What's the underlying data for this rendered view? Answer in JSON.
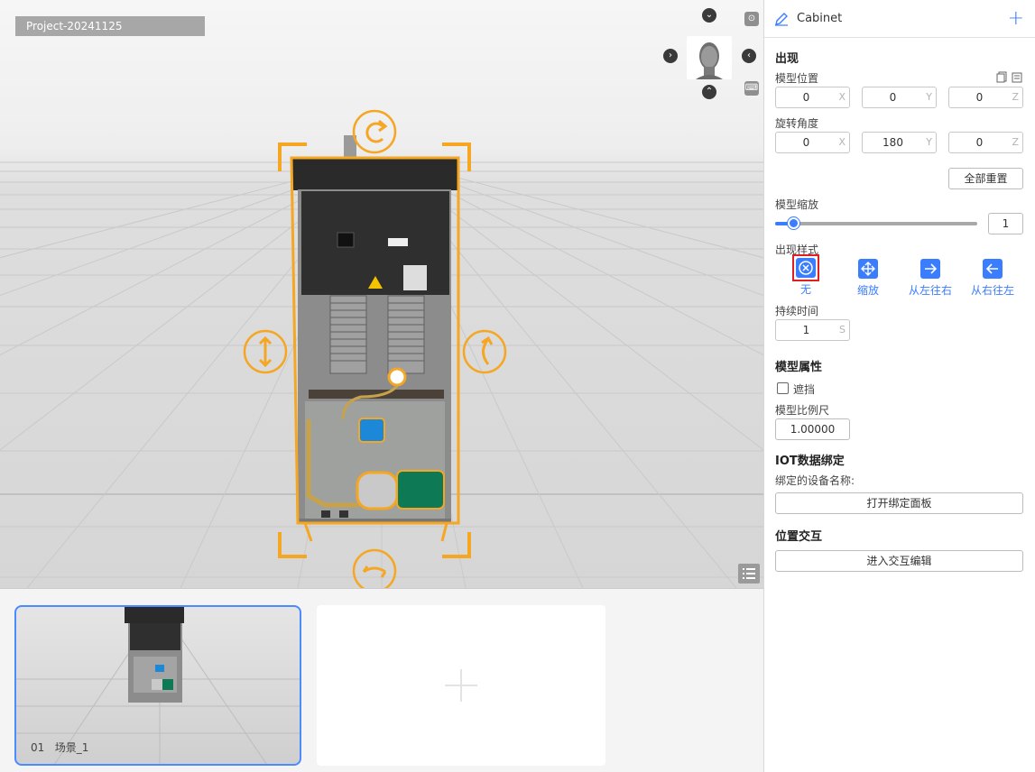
{
  "viewport": {
    "project_name": "Project-20241125"
  },
  "panel": {
    "header_title": "Cabinet",
    "section_appear": "出现",
    "position_label": "模型位置",
    "position": {
      "x": "0",
      "y": "0",
      "z": "0"
    },
    "rotation_label": "旋转角度",
    "rotation": {
      "x": "0",
      "y": "180",
      "z": "0"
    },
    "axis_x": "X",
    "axis_y": "Y",
    "axis_z": "Z",
    "reset_all": "全部重置",
    "scale_label": "模型缩放",
    "scale_value": "1",
    "scale_fraction": 0.09,
    "appear_style_label": "出现样式",
    "styles": [
      "无",
      "缩放",
      "从左往右",
      "从右往左"
    ],
    "duration_label": "持续时间",
    "duration_value": "1",
    "duration_unit": "S",
    "section_model_attr": "模型属性",
    "occlude_label": "遮挡",
    "model_scale_ruler_label": "模型比例尺",
    "model_scale_ruler_value": "1.00000",
    "section_iot": "IOT数据绑定",
    "bound_device_label": "绑定的设备名称:",
    "open_bind_panel": "打开绑定面板",
    "section_position_interact": "位置交互",
    "enter_interact_edit": "进入交互编辑"
  },
  "scenes": [
    {
      "index": "01",
      "name": "场景_1"
    }
  ],
  "colors": {
    "accent": "#3a7dff",
    "selection": "#f5a623",
    "selected_outline": "#e02020"
  }
}
